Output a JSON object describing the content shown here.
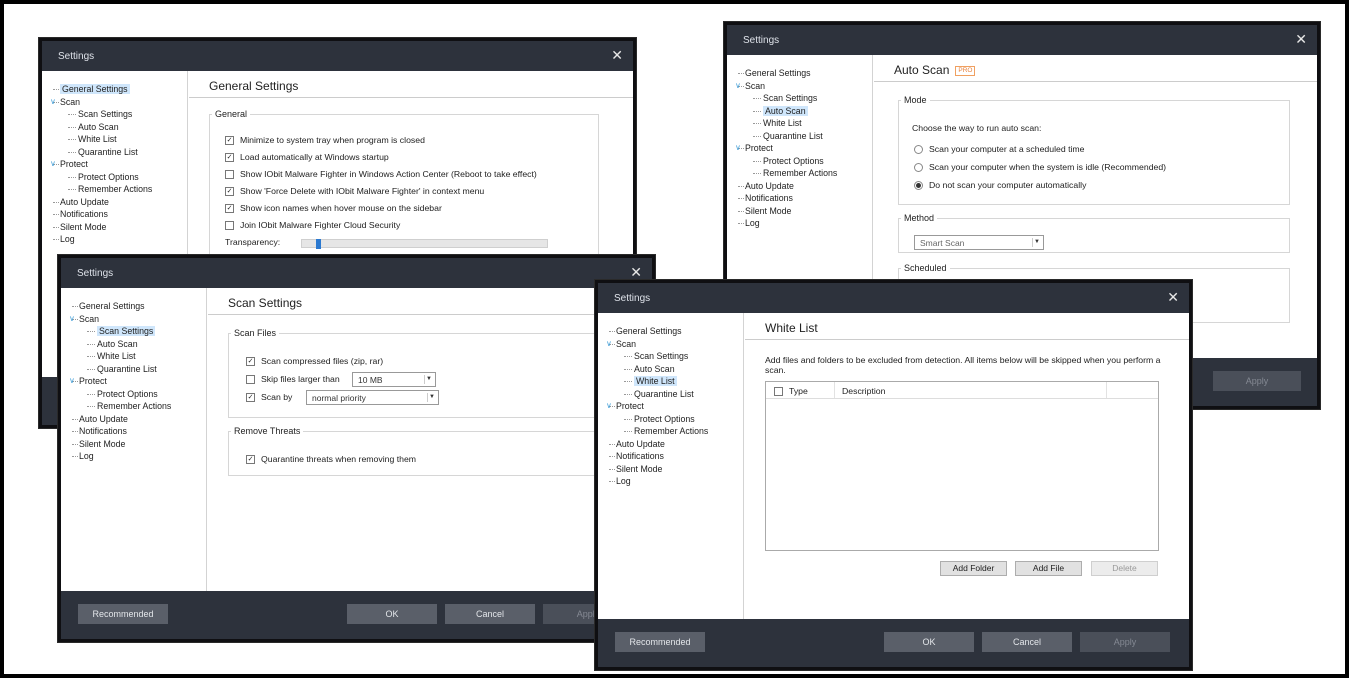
{
  "tree": {
    "general_settings": "General Settings",
    "scan": "Scan",
    "scan_settings": "Scan Settings",
    "auto_scan": "Auto Scan",
    "white_list": "White List",
    "quarantine_list": "Quarantine List",
    "protect": "Protect",
    "protect_options": "Protect Options",
    "remember_actions": "Remember Actions",
    "auto_update": "Auto Update",
    "notifications": "Notifications",
    "silent_mode": "Silent Mode",
    "log": "Log"
  },
  "window_title": "Settings",
  "general": {
    "heading": "General Settings",
    "group": "General",
    "options": [
      {
        "label": "Minimize to system tray when program is closed",
        "checked": true
      },
      {
        "label": "Load automatically at Windows startup",
        "checked": true
      },
      {
        "label": "Show IObit Malware Fighter in Windows Action Center (Reboot to take effect)",
        "checked": false
      },
      {
        "label": "Show 'Force Delete with IObit Malware Fighter' in context menu",
        "checked": true
      },
      {
        "label": "Show icon names when hover mouse on the sidebar",
        "checked": true
      },
      {
        "label": "Join IObit Malware Fighter Cloud Security",
        "checked": false
      }
    ],
    "transparency_label": "Transparency:",
    "transparency_level": 0.06
  },
  "scan_settings": {
    "heading": "Scan Settings",
    "scan_files_group": "Scan Files",
    "compressed": "Scan compressed files (zip, rar)",
    "skip_larger": "Skip files larger than",
    "skip_size": "10 MB",
    "scan_by": "Scan by",
    "priority": "normal priority",
    "remove_group": "Remove Threats",
    "quarantine": "Quarantine threats when removing them",
    "recommended": "Recommended",
    "ok": "OK",
    "cancel": "Cancel",
    "apply": "Apply"
  },
  "auto_scan": {
    "heading": "Auto Scan",
    "badge": "PRO",
    "mode_group": "Mode",
    "mode_prompt": "Choose the way to run auto scan:",
    "modes": [
      {
        "label": "Scan your computer at a scheduled time",
        "selected": false
      },
      {
        "label": "Scan your computer when the system is idle (Recommended)",
        "selected": false
      },
      {
        "label": "Do not scan your computer automatically",
        "selected": true
      }
    ],
    "method_group": "Method",
    "method_value": "Smart Scan",
    "scheduled_group": "Scheduled",
    "apply": "Apply"
  },
  "white_list": {
    "heading": "White List",
    "description": "Add files and folders to be excluded from detection. All items below will be skipped when you perform a scan.",
    "col_type": "Type",
    "col_description": "Description",
    "add_folder": "Add Folder",
    "add_file": "Add File",
    "delete": "Delete",
    "recommended": "Recommended",
    "ok": "OK",
    "cancel": "Cancel",
    "apply": "Apply"
  }
}
